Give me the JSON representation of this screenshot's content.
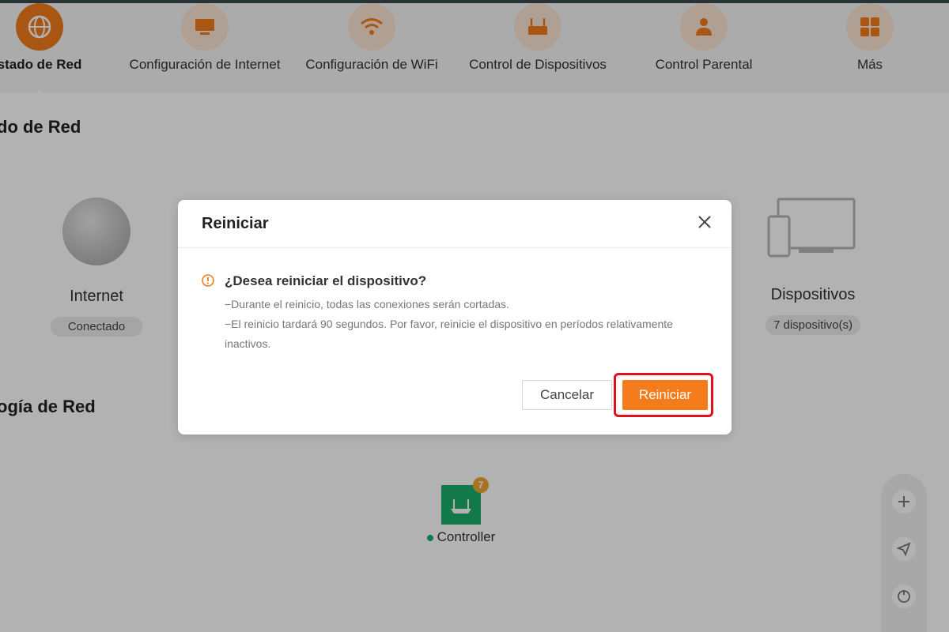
{
  "nav": {
    "items": [
      {
        "label": "stado de Red",
        "icon": "globe-icon",
        "active": true
      },
      {
        "label": "Configuración de Internet",
        "icon": "monitor-icon",
        "active": false
      },
      {
        "label": "Configuración de WiFi",
        "icon": "wifi-icon",
        "active": false
      },
      {
        "label": "Control de Dispositivos",
        "icon": "router-icon",
        "active": false
      },
      {
        "label": "Control Parental",
        "icon": "parent-icon",
        "active": false
      },
      {
        "label": "Más",
        "icon": "grid-icon",
        "active": false
      }
    ]
  },
  "section1": {
    "title": "do de Red"
  },
  "internet_card": {
    "label": "Internet",
    "status": "Conectado"
  },
  "devices_card": {
    "label": "Dispositivos",
    "count": "7 dispositivo(s)"
  },
  "section2": {
    "title": "ogía de Red"
  },
  "topology": {
    "controller_label": "Controller",
    "badge": "7"
  },
  "toolbar": {
    "buttons": [
      "plus-icon",
      "send-icon",
      "power-icon"
    ]
  },
  "modal": {
    "title": "Reiniciar",
    "question": "¿Desea reiniciar el dispositivo?",
    "line1": "−Durante el reinicio, todas las conexiones serán cortadas.",
    "line2": "−El reinicio tardará 90 segundos. Por favor, reinicie el dispositivo en períodos relativamente",
    "line3": "inactivos.",
    "cancel_label": "Cancelar",
    "reboot_label": "Reiniciar"
  },
  "colors": {
    "accent": "#f47c1c",
    "highlight": "#e0101c",
    "online": "#1eae6a"
  }
}
